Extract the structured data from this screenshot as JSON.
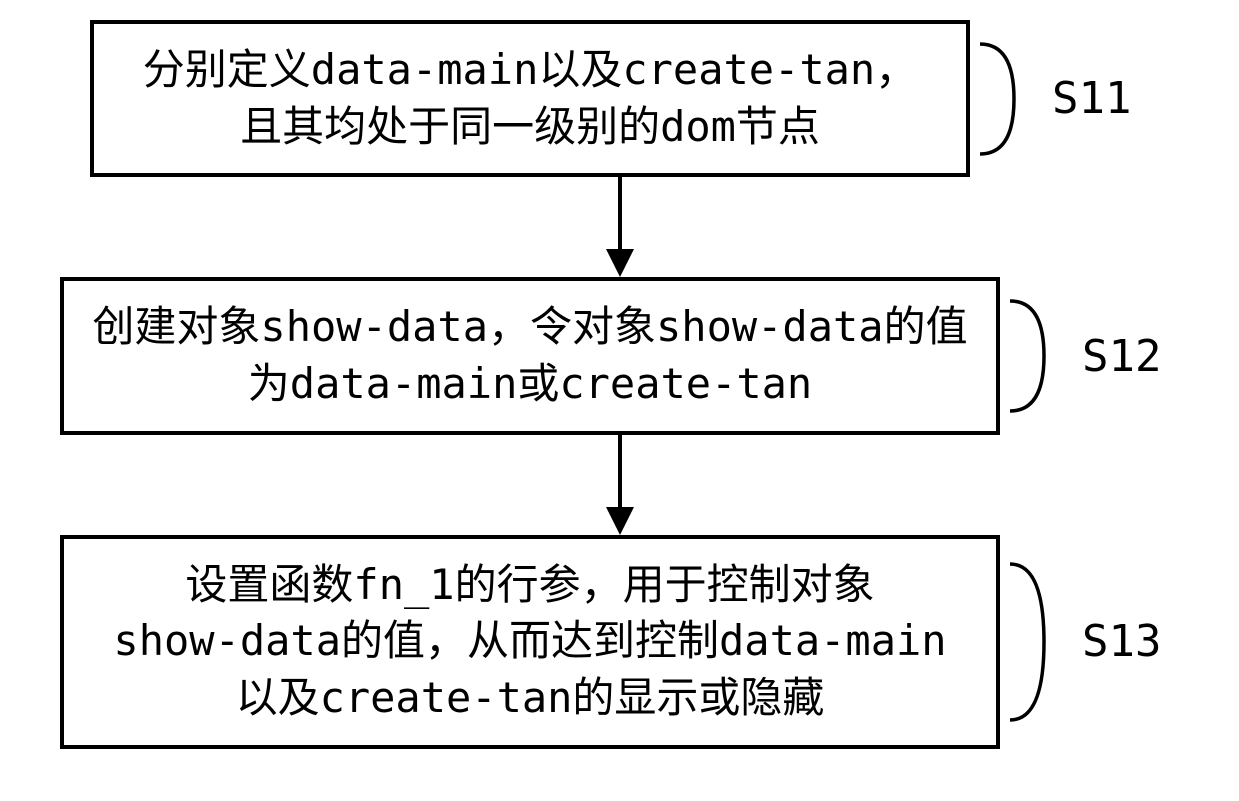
{
  "steps": [
    {
      "id": "S11",
      "line1": "分别定义data-main以及create-tan，",
      "line2": "且其均处于同一级别的dom节点"
    },
    {
      "id": "S12",
      "line1": "创建对象show-data，令对象show-data的值",
      "line2": "为data-main或create-tan"
    },
    {
      "id": "S13",
      "line1": "设置函数fn_1的行参，用于控制对象",
      "line2": "show-data的值，从而达到控制data-main",
      "line3": "以及create-tan的显示或隐藏"
    }
  ]
}
